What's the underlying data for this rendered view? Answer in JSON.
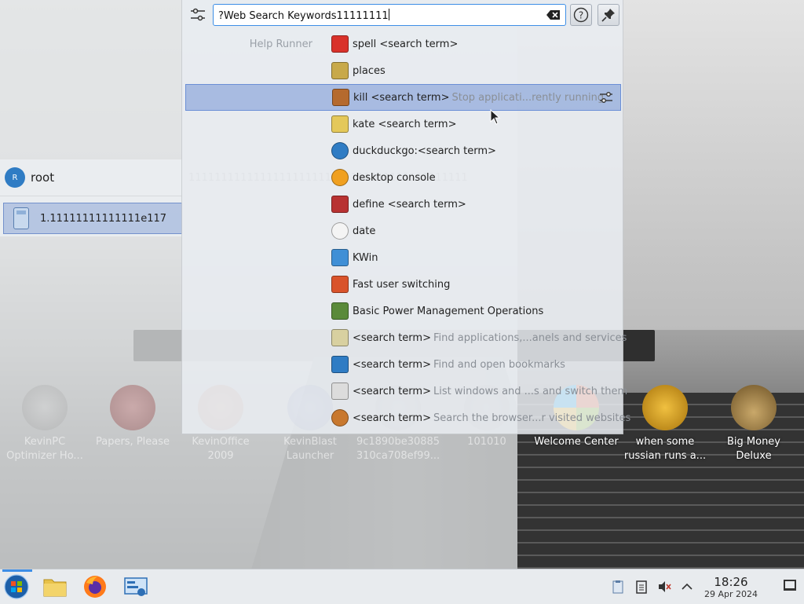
{
  "krunner": {
    "query": "?Web Search Keywords11111111",
    "help_runner_category": "Help Runner",
    "results": [
      {
        "icon": "spell-icon",
        "label": "spell <search term>",
        "sub": ""
      },
      {
        "icon": "places-icon",
        "label": "places",
        "sub": ""
      },
      {
        "icon": "kill-icon",
        "label": "kill <search term>",
        "sub": "Stop applicati...rently running",
        "selected": true
      },
      {
        "icon": "kate-icon",
        "label": "kate <search term>",
        "sub": ""
      },
      {
        "icon": "duckduckgo-icon",
        "label": "duckduckgo:<search term>",
        "sub": ""
      },
      {
        "icon": "desktop-console-icon",
        "label": "desktop console",
        "sub": ""
      },
      {
        "icon": "dictionary-icon",
        "label": "define <search term>",
        "sub": ""
      },
      {
        "icon": "clock-icon",
        "label": "date",
        "sub": ""
      },
      {
        "icon": "kwin-icon",
        "label": "KWin",
        "sub": ""
      },
      {
        "icon": "power-icon",
        "label": "Fast user switching",
        "sub": ""
      },
      {
        "icon": "battery-icon",
        "label": "Basic Power Management Operations",
        "sub": ""
      },
      {
        "icon": "apps-icon",
        "label": "<search term>",
        "sub": "Find applications,...anels and services"
      },
      {
        "icon": "bookmarks-icon",
        "label": "<search term>",
        "sub": "Find and open bookmarks"
      },
      {
        "icon": "windows-icon",
        "label": "<search term>",
        "sub": "List windows and ...s and switch them"
      },
      {
        "icon": "history-icon",
        "label": "<search term>",
        "sub": "Search the browser...r visited websites"
      }
    ]
  },
  "user_panel": {
    "avatar_letter": "R",
    "user_name": "root",
    "calc_result": "1.11111111111111e117"
  },
  "ghost_text": "1111111111111111111111111111111111111111111",
  "desktop_icons": [
    {
      "label": "KevinPC Optimizer Ho...",
      "faded": true
    },
    {
      "label": "Papers, Please",
      "faded": true
    },
    {
      "label": "KevinOffice 2009",
      "faded": true
    },
    {
      "label": "KevinBlast Launcher",
      "faded": true
    },
    {
      "label": "9c1890be30885 310ca708ef99...",
      "faded": true
    },
    {
      "label": "101010",
      "faded": true
    },
    {
      "label": "Welcome Center",
      "faded": false
    },
    {
      "label": "when some russian runs a...",
      "faded": false
    },
    {
      "label": "Big Money Deluxe",
      "faded": false
    }
  ],
  "taskbar": {
    "time": "18:26",
    "date": "29 Apr 2024"
  },
  "colors": {
    "accent": "#3d8ee6",
    "selection": "#7d9bd7"
  }
}
